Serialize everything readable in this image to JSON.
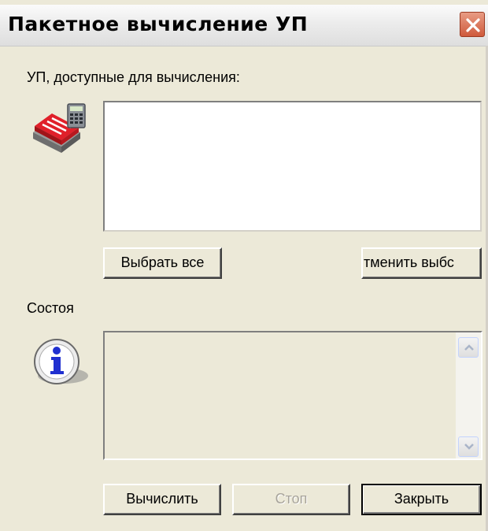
{
  "window": {
    "title": "Пакетное вычисление УП"
  },
  "programs": {
    "label": "УП, доступные для вычисления:",
    "items": []
  },
  "buttons": {
    "select_all": "Выбрать все",
    "deselect": "тменить выбс",
    "compute": "Вычислить",
    "stop": "Стоп",
    "close": "Закрыть"
  },
  "status": {
    "label": "Состоя"
  },
  "icons": {
    "close": "close-icon",
    "programs": "calculator-stack-icon",
    "info": "info-icon",
    "scroll_up": "chevron-up-icon",
    "scroll_down": "chevron-down-icon"
  },
  "colors": {
    "window_bg": "#ece9d8",
    "close_button": "#cf5a3c",
    "info_blue": "#2030d0",
    "stack_red": "#e0202a"
  }
}
